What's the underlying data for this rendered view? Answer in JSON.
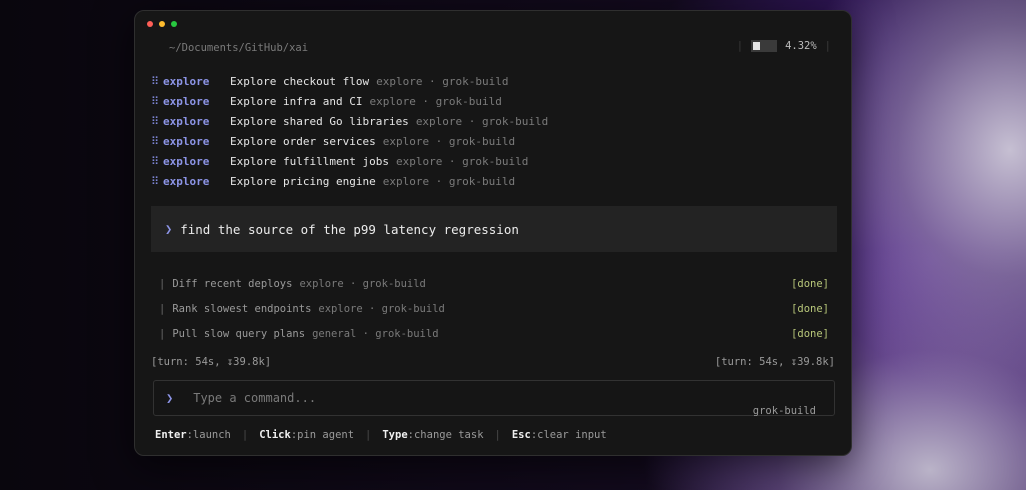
{
  "window": {
    "path": "~/Documents/GitHub/xai",
    "usage_percent": "4.32%",
    "usage_fraction": 0.0432
  },
  "agents": [
    {
      "type": "explore",
      "task": "Explore checkout flow",
      "meta": "explore · grok-build"
    },
    {
      "type": "explore",
      "task": "Explore infra and CI",
      "meta": "explore · grok-build"
    },
    {
      "type": "explore",
      "task": "Explore shared Go libraries",
      "meta": "explore · grok-build"
    },
    {
      "type": "explore",
      "task": "Explore order services",
      "meta": "explore · grok-build"
    },
    {
      "type": "explore",
      "task": "Explore fulfillment jobs",
      "meta": "explore · grok-build"
    },
    {
      "type": "explore",
      "task": "Explore pricing engine",
      "meta": "explore · grok-build"
    }
  ],
  "prompt": {
    "caret": "❯",
    "text": "find the source of the p99 latency regression"
  },
  "subtasks": [
    {
      "task": "Diff recent deploys",
      "meta": "explore · grok-build",
      "status": "[done]"
    },
    {
      "task": "Rank slowest endpoints",
      "meta": "explore · grok-build",
      "status": "[done]"
    },
    {
      "task": "Pull slow query plans",
      "meta": "general · grok-build",
      "status": "[done]"
    }
  ],
  "turn": {
    "left": "[turn: 54s, ↧39.8k]",
    "right": "[turn: 54s, ↧39.8k]"
  },
  "command": {
    "caret": "❯",
    "placeholder": "Type a command...",
    "value": "",
    "model": "grok-build"
  },
  "hints": [
    {
      "key": "Enter",
      "desc": ":launch"
    },
    {
      "key": "Click",
      "desc": ":pin agent"
    },
    {
      "key": "Type",
      "desc": ":change task"
    },
    {
      "key": "Esc",
      "desc": ":clear input"
    }
  ],
  "icons": {
    "agent_marker": "⠿",
    "subtask_marker": "|",
    "separator": "|"
  },
  "colors": {
    "accent": "#8c94e6",
    "done": "#b8c77a",
    "traffic_red": "#ff5f57",
    "traffic_yellow": "#febc2e",
    "traffic_green": "#28c840"
  }
}
